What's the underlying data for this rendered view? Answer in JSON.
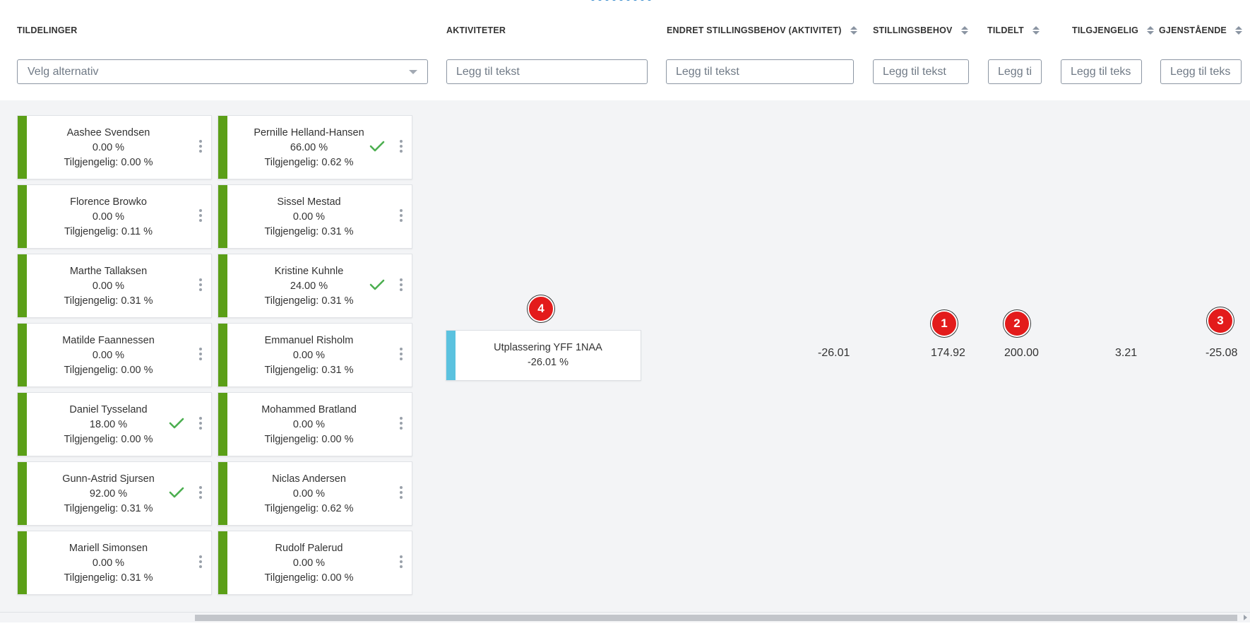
{
  "headers": {
    "tildelinger": "TILDELINGER",
    "aktiviteter": "AKTIVITETER",
    "endret": "ENDRET STILLINGSBEHOV (AKTIVITET)",
    "stillingsbehov": "STILLINGSBEHOV",
    "tildelt": "TILDELT",
    "tilgjengelig": "TILGJENGELIG",
    "gjenstaende": "GJENSTÅENDE"
  },
  "filters": {
    "select_placeholder": "Velg alternativ",
    "text_placeholder": "Legg til tekst",
    "text_placeholder_tildelt": "Legg ti",
    "text_placeholder_tilgjengelig": "Legg til teks",
    "text_placeholder_gjenstaende": "Legg til teks"
  },
  "persons": [
    {
      "name": "Aashee Svendsen",
      "percent": "0.00 %",
      "available": "Tilgjengelig: 0.00 %",
      "checked": false
    },
    {
      "name": "Pernille Helland-Hansen",
      "percent": "66.00 %",
      "available": "Tilgjengelig: 0.62 %",
      "checked": true
    },
    {
      "name": "Florence Browko",
      "percent": "0.00 %",
      "available": "Tilgjengelig: 0.11 %",
      "checked": false
    },
    {
      "name": "Sissel Mestad",
      "percent": "0.00 %",
      "available": "Tilgjengelig: 0.31 %",
      "checked": false
    },
    {
      "name": "Marthe Tallaksen",
      "percent": "0.00 %",
      "available": "Tilgjengelig: 0.31 %",
      "checked": false
    },
    {
      "name": "Kristine Kuhnle",
      "percent": "24.00 %",
      "available": "Tilgjengelig: 0.31 %",
      "checked": true
    },
    {
      "name": "Matilde Faannessen",
      "percent": "0.00 %",
      "available": "Tilgjengelig: 0.00 %",
      "checked": false
    },
    {
      "name": "Emmanuel Risholm",
      "percent": "0.00 %",
      "available": "Tilgjengelig: 0.31 %",
      "checked": false
    },
    {
      "name": "Daniel Tysseland",
      "percent": "18.00 %",
      "available": "Tilgjengelig: 0.00 %",
      "checked": true
    },
    {
      "name": "Mohammed Bratland",
      "percent": "0.00 %",
      "available": "Tilgjengelig: 0.00 %",
      "checked": false
    },
    {
      "name": "Gunn-Astrid Sjursen",
      "percent": "92.00 %",
      "available": "Tilgjengelig: 0.31 %",
      "checked": true
    },
    {
      "name": "Niclas Andersen",
      "percent": "0.00 %",
      "available": "Tilgjengelig: 0.62 %",
      "checked": false
    },
    {
      "name": "Mariell Simonsen",
      "percent": "0.00 %",
      "available": "Tilgjengelig: 0.31 %",
      "checked": false
    },
    {
      "name": "Rudolf Palerud",
      "percent": "0.00 %",
      "available": "Tilgjengelig: 0.00 %",
      "checked": false
    }
  ],
  "activity": {
    "name": "Utplassering YFF 1NAA",
    "percent": "-26.01 %"
  },
  "values": {
    "endret": "-26.01",
    "stillingsbehov": "174.92",
    "tildelt": "200.00",
    "tilgjengelig": "3.21",
    "gjenstaende": "-25.08"
  },
  "markers": {
    "m1": "1",
    "m2": "2",
    "m3": "3",
    "m4": "4"
  },
  "colors": {
    "assigned_bar": "#5b9f17",
    "activity_bar": "#5bc2df",
    "marker": "#e31b1b",
    "check": "#4caf50"
  }
}
